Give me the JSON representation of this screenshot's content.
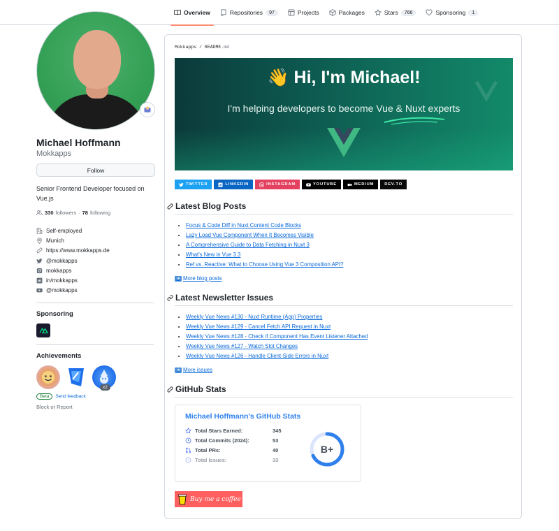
{
  "nav": {
    "tabs": [
      {
        "label": "Overview",
        "count": ""
      },
      {
        "label": "Repositories",
        "count": "97"
      },
      {
        "label": "Projects",
        "count": ""
      },
      {
        "label": "Packages",
        "count": ""
      },
      {
        "label": "Stars",
        "count": "766"
      },
      {
        "label": "Sponsoring",
        "count": "1"
      }
    ]
  },
  "profile": {
    "name": "Michael Hoffmann",
    "login": "Mokkapps",
    "follow_label": "Follow",
    "bio": "Senior Frontend Developer focused on Vue.js",
    "followers": "330",
    "followers_label": "followers",
    "following": "78",
    "following_label": "following",
    "meta": [
      {
        "icon": "organization-icon",
        "text": "Self-employed"
      },
      {
        "icon": "location-icon",
        "text": "Munich"
      },
      {
        "icon": "link-icon",
        "text": "https://www.mokkapps.de"
      },
      {
        "icon": "twitter-icon",
        "text": "@mokkapps"
      },
      {
        "icon": "instagram-icon",
        "text": "mokkapps"
      },
      {
        "icon": "linkedin-icon",
        "text": "in/mokkapps"
      },
      {
        "icon": "youtube-icon",
        "text": "@mokkapps"
      }
    ],
    "sponsoring_heading": "Sponsoring",
    "achievements_heading": "Achievements",
    "achievement_multiplier": "x2",
    "beta_label": "Beta",
    "feedback_label": "Send feedback",
    "block_label": "Block or Report"
  },
  "readme": {
    "path_owner": "Mokkapps",
    "path_sep": " / ",
    "path_file": "README",
    "path_ext": ".md",
    "banner_title": "👋 Hi, I'm Michael!",
    "banner_subtitle": "I'm helping developers to become Vue & Nuxt experts",
    "socials": [
      {
        "label": "TWITTER",
        "color": "#1da1f2"
      },
      {
        "label": "LINKEDIN",
        "color": "#0a66c2"
      },
      {
        "label": "INSTAGRAM",
        "color": "#e4405f"
      },
      {
        "label": "YOUTUBE",
        "color": "#000000"
      },
      {
        "label": "MEDIUM",
        "color": "#000000"
      },
      {
        "label": "DEV.TO",
        "color": "#0a0a0a"
      }
    ],
    "blog_heading": "Latest Blog Posts",
    "blog_posts": [
      "Focus & Code Diff in Nuxt Content Code Blocks",
      "Lazy Load Vue Component When It Becomes Visible",
      "A Comprehensive Guide to Data Fetching in Nuxt 3",
      "What's New in Vue 3.3",
      "Ref vs. Reactive: What to Choose Using Vue 3 Composition API?"
    ],
    "more_posts": "More blog posts",
    "newsletter_heading": "Latest Newsletter Issues",
    "newsletter_issues": [
      "Weekly Vue News #130 - Nuxt Runtime (App) Properties",
      "Weekly Vue News #129 - Cancel Fetch API Request in Nuxt",
      "Weekly Vue News #128 - Check if Component Has Event Listener Attached",
      "Weekly Vue News #127 - Watch Slot Changes",
      "Weekly Vue News #126 - Handle Client-Side Errors in Nuxt"
    ],
    "more_issues": "More issues",
    "stats_heading": "GitHub Stats",
    "stats": {
      "title": "Michael Hoffmann's GitHub Stats",
      "rows": [
        {
          "icon": "star-icon",
          "label": "Total Stars Earned:",
          "value": "345"
        },
        {
          "icon": "history-icon",
          "label": "Total Commits (2024):",
          "value": "53"
        },
        {
          "icon": "pull-request-icon",
          "label": "Total PRs:",
          "value": "40"
        },
        {
          "icon": "issue-icon",
          "label": "Total Issues:",
          "value": "33"
        }
      ],
      "grade": "B+",
      "grade_progress": 0.68
    },
    "bmc_label": "Buy me a coffee"
  },
  "colors": {
    "accent": "#fd8c73",
    "link": "#0969da",
    "stats_title": "#2f80ed",
    "bmc": "#ff5f5f"
  }
}
